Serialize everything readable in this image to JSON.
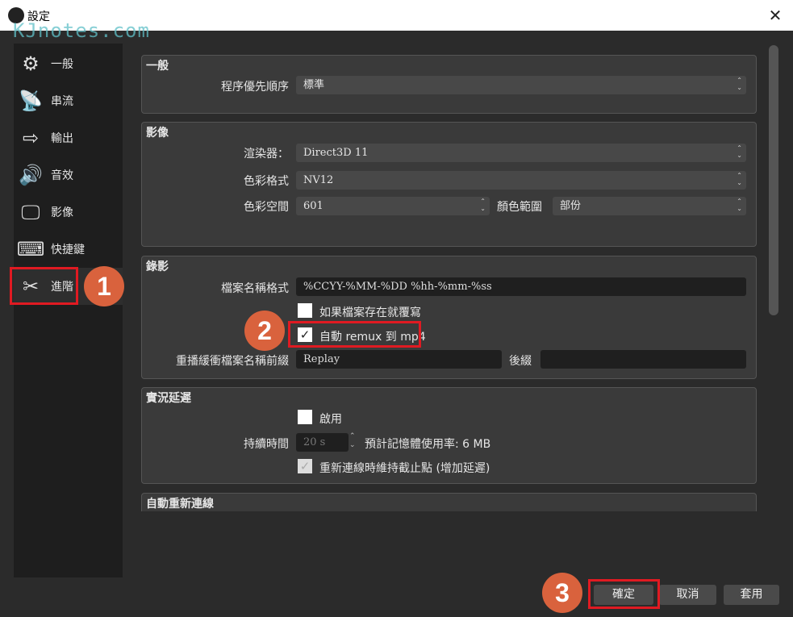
{
  "window": {
    "title": "設定",
    "watermark": "KJnotes.com",
    "close_icon": "close-icon"
  },
  "sidebar": {
    "items": [
      {
        "label": "一般",
        "icon": "gear-icon",
        "glyph": "⚙"
      },
      {
        "label": "串流",
        "icon": "antenna-icon",
        "glyph": "📡"
      },
      {
        "label": "輸出",
        "icon": "output-monitor-icon",
        "glyph": "⇨"
      },
      {
        "label": "音效",
        "icon": "speaker-icon",
        "glyph": "🔊"
      },
      {
        "label": "影像",
        "icon": "monitor-icon",
        "glyph": "🖵"
      },
      {
        "label": "快捷鍵",
        "icon": "keyboard-icon",
        "glyph": "⌨"
      },
      {
        "label": "進階",
        "icon": "tools-icon",
        "glyph": "✂",
        "selected": true
      }
    ]
  },
  "general": {
    "title": "一般",
    "priority_label": "程序優先順序",
    "priority_value": "標準"
  },
  "video": {
    "title": "影像",
    "renderer_label": "渲染器：",
    "renderer_value": "Direct3D 11",
    "color_format_label": "色彩格式",
    "color_format_value": "NV12",
    "color_space_label": "色彩空間",
    "color_space_value": "601",
    "color_range_label": "顏色範圍",
    "color_range_value": "部份"
  },
  "recording": {
    "title": "錄影",
    "filename_label": "檔案名稱格式",
    "filename_value": "%CCYY-%MM-%DD %hh-%mm-%ss",
    "overwrite_label": "如果檔案存在就覆寫",
    "overwrite_checked": false,
    "remux_label": "自動 remux 到 mp4",
    "remux_checked": true,
    "replay_prefix_label": "重播緩衝檔案名稱前綴",
    "replay_prefix_value": "Replay",
    "suffix_label": "後綴",
    "suffix_value": ""
  },
  "stream_delay": {
    "title": "實況延遲",
    "enable_label": "啟用",
    "enable_checked": false,
    "duration_label": "持續時間",
    "duration_value": "20 s",
    "memory_text": "預計記憶體使用率: 6 MB",
    "preserve_label": "重新連線時維持截止點 (增加延遲)",
    "preserve_checked": true
  },
  "reconnect": {
    "title": "自動重新連線"
  },
  "buttons": {
    "ok": "確定",
    "cancel": "取消",
    "apply": "套用"
  },
  "annotations": [
    "1",
    "2",
    "3"
  ],
  "colors": {
    "badge": "#d9623d",
    "highlight": "#e01a22"
  }
}
